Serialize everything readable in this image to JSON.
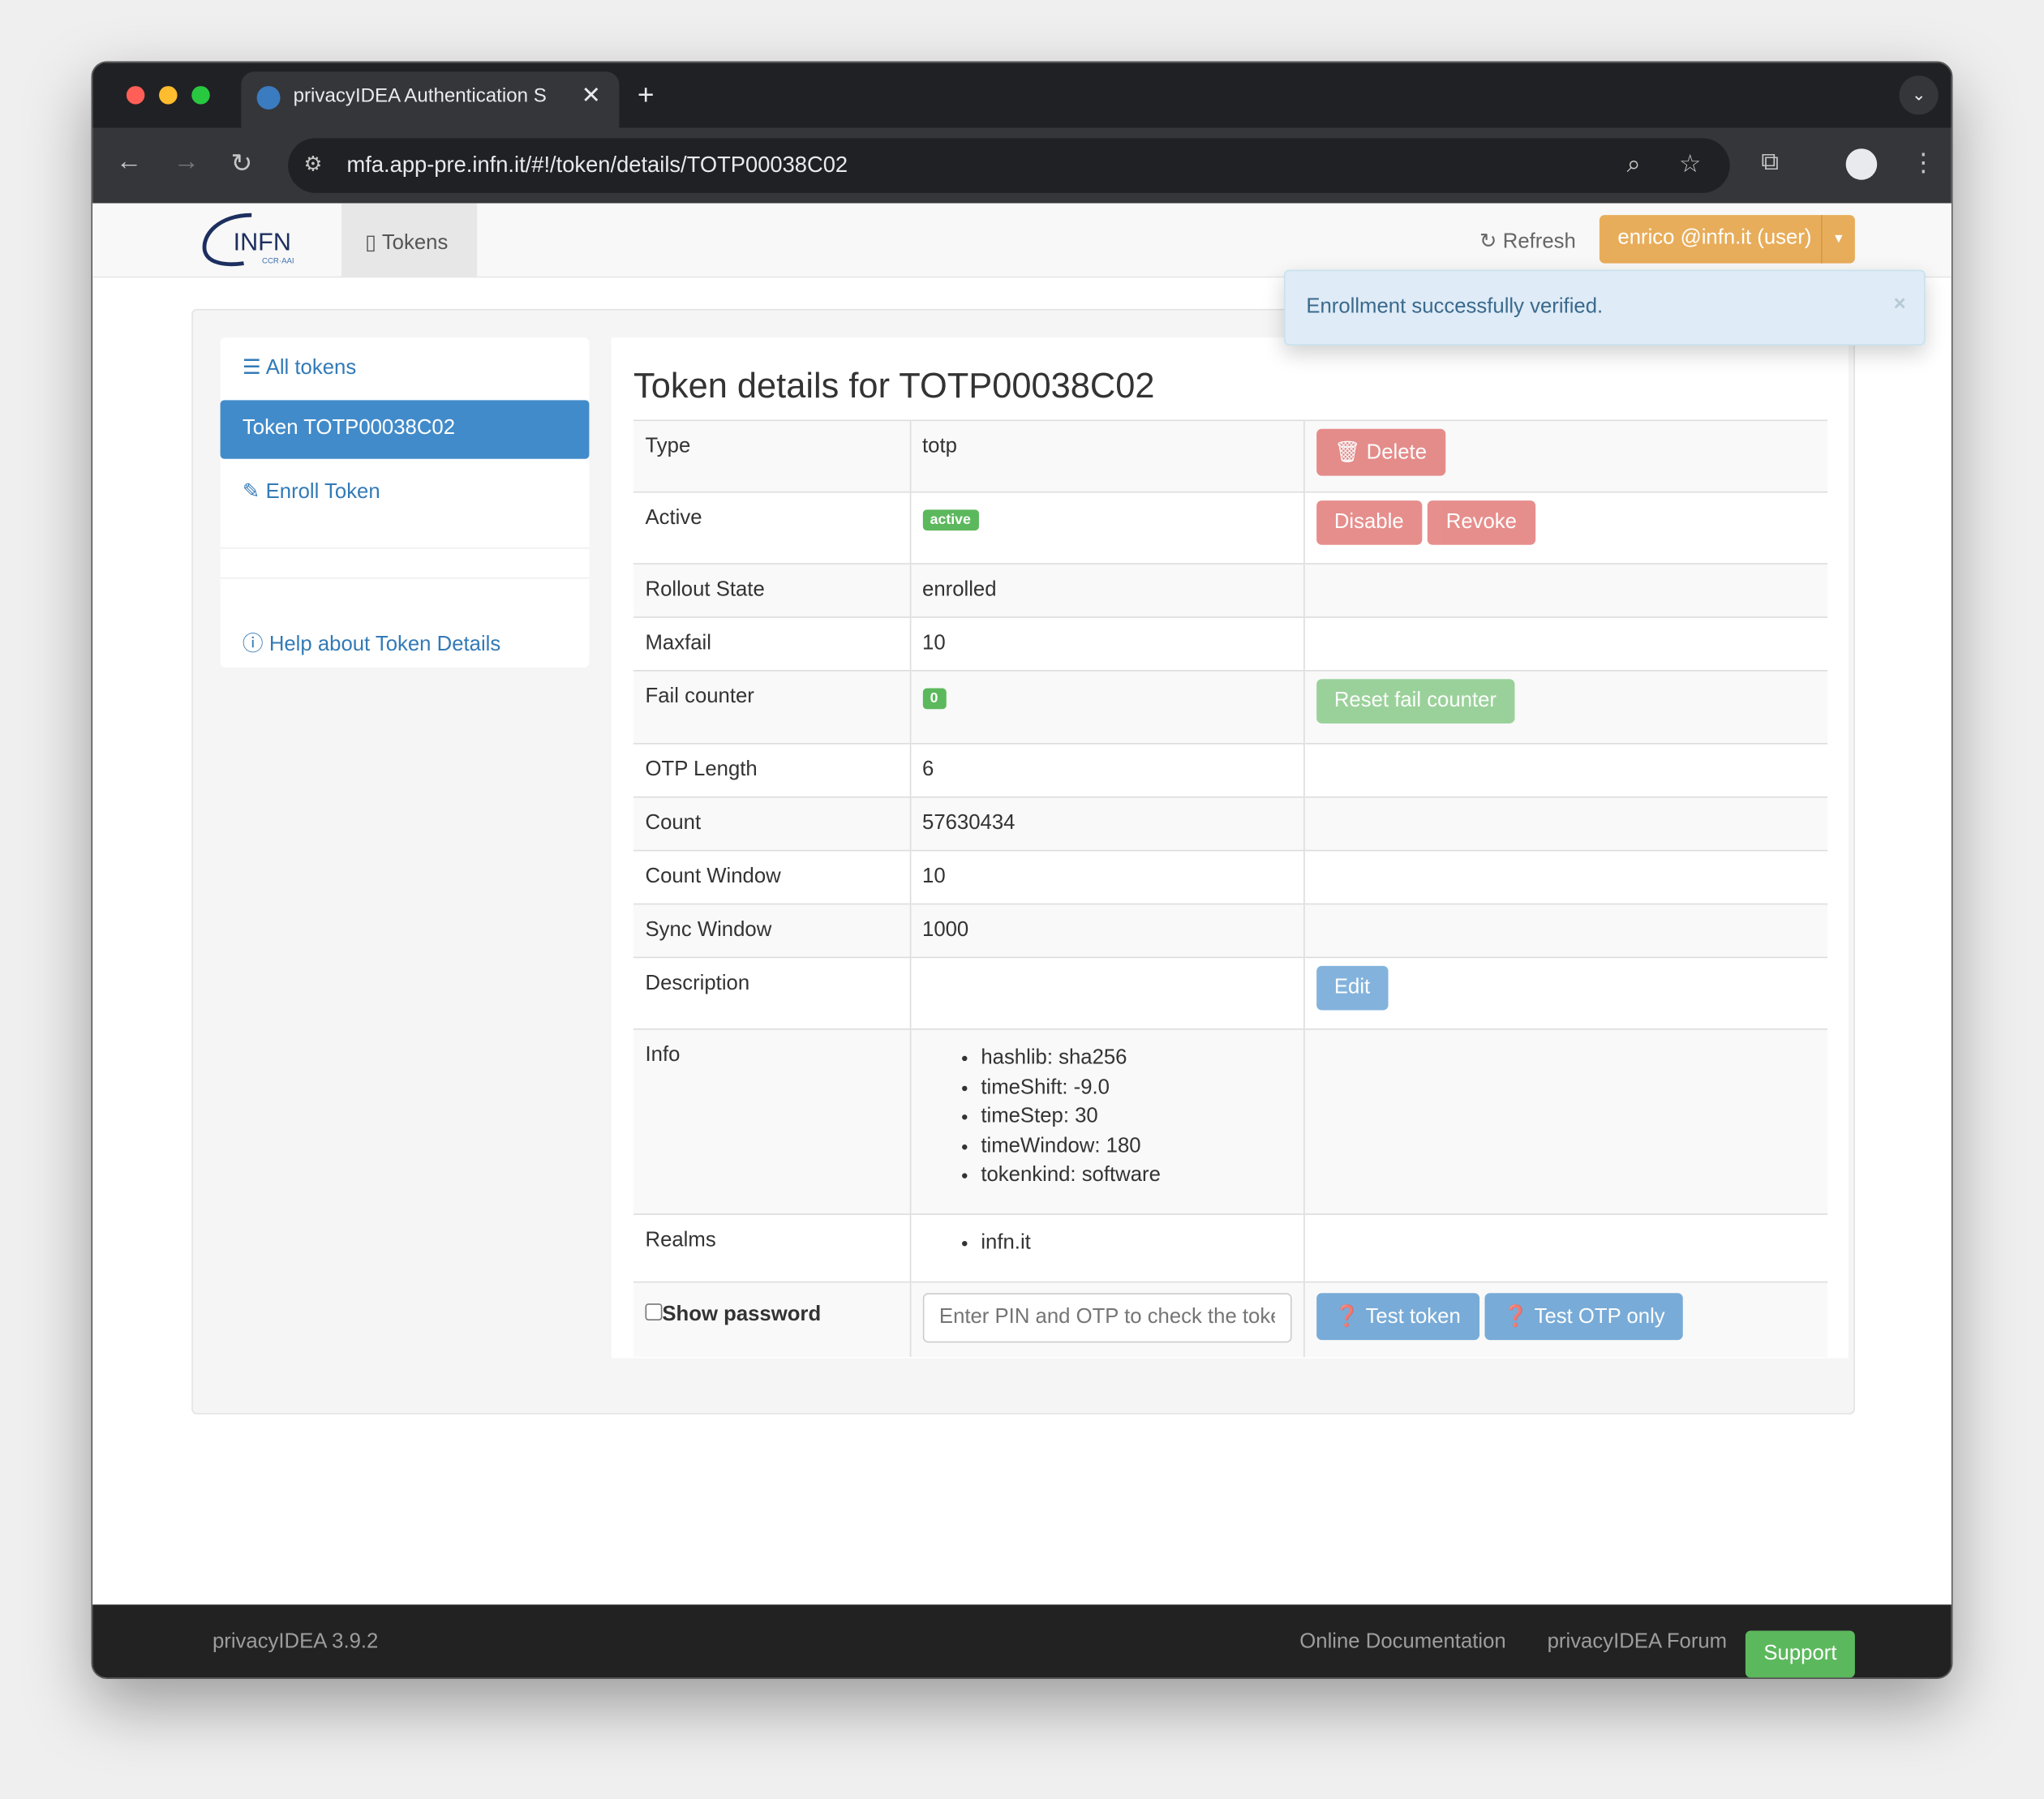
{
  "browser": {
    "tab_title": "privacyIDEA Authentication S",
    "url": "mfa.app-pre.infn.it/#!/token/details/TOTP00038C02"
  },
  "header": {
    "logo_text": "INFN",
    "logo_sub": "CCR · AAI",
    "nav_tokens": "Tokens",
    "refresh": "Refresh",
    "user": "enrico @infn.it (user)"
  },
  "alert": {
    "message": "Enrollment successfully verified.",
    "close": "×"
  },
  "sidebar": {
    "items": [
      {
        "label": "All tokens"
      },
      {
        "label": "Token TOTP00038C02"
      },
      {
        "label": "Enroll Token"
      },
      {
        "label": "Help about Token Details"
      }
    ]
  },
  "main": {
    "title": "Token details for TOTP00038C02",
    "rows": {
      "type": {
        "label": "Type",
        "value": "totp"
      },
      "active": {
        "label": "Active",
        "value": "active"
      },
      "rollout": {
        "label": "Rollout State",
        "value": "enrolled"
      },
      "maxfail": {
        "label": "Maxfail",
        "value": "10"
      },
      "failcounter": {
        "label": "Fail counter",
        "value": "0"
      },
      "otplen": {
        "label": "OTP Length",
        "value": "6"
      },
      "count": {
        "label": "Count",
        "value": "57630434"
      },
      "countwindow": {
        "label": "Count Window",
        "value": "10"
      },
      "syncwindow": {
        "label": "Sync Window",
        "value": "1000"
      },
      "description": {
        "label": "Description",
        "value": ""
      },
      "info": {
        "label": "Info",
        "items": [
          "hashlib: sha256",
          "timeShift: -9.0",
          "timeStep: 30",
          "timeWindow: 180",
          "tokenkind: software"
        ]
      },
      "realms": {
        "label": "Realms",
        "items": [
          "infn.it"
        ]
      }
    },
    "buttons": {
      "delete": "Delete",
      "disable": "Disable",
      "revoke": "Revoke",
      "reset": "Reset fail counter",
      "edit": "Edit",
      "test_token": "Test token",
      "test_otp": "Test OTP only"
    },
    "show_password": "Show password",
    "pin_placeholder": "Enter PIN and OTP to check the token"
  },
  "footer": {
    "version": "privacyIDEA 3.9.2",
    "docs": "Online Documentation",
    "forum": "privacyIDEA Forum",
    "support": "Support"
  }
}
